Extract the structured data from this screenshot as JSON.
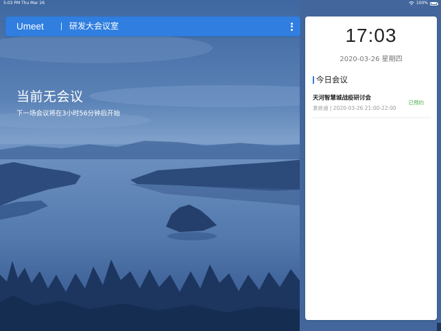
{
  "status_bar": {
    "time": "5:03 PM",
    "date": "Thu Mar 26",
    "battery": "100%",
    "icons": [
      "wifi-icon",
      "battery-icon"
    ]
  },
  "header": {
    "brand": "Umeet",
    "room_name": "研发大会议室",
    "menu_icon": "more-vertical-icon"
  },
  "main": {
    "status_title": "当前无会议",
    "next_meeting_text": "下一场会议将在3小时56分钟后开始"
  },
  "panel": {
    "clock": "17:03",
    "date": "2020-03-26 星期四",
    "section_title": "今日会议",
    "meetings": [
      {
        "title": "天河智慧城战疫研讨会",
        "meta": "袁依涵 | 2020-03-26 21:00-22:00",
        "status": "已预约"
      }
    ]
  },
  "colors": {
    "accent": "#2f7ee0",
    "background": "#3a5f95",
    "status_booked": "#4caf50"
  }
}
